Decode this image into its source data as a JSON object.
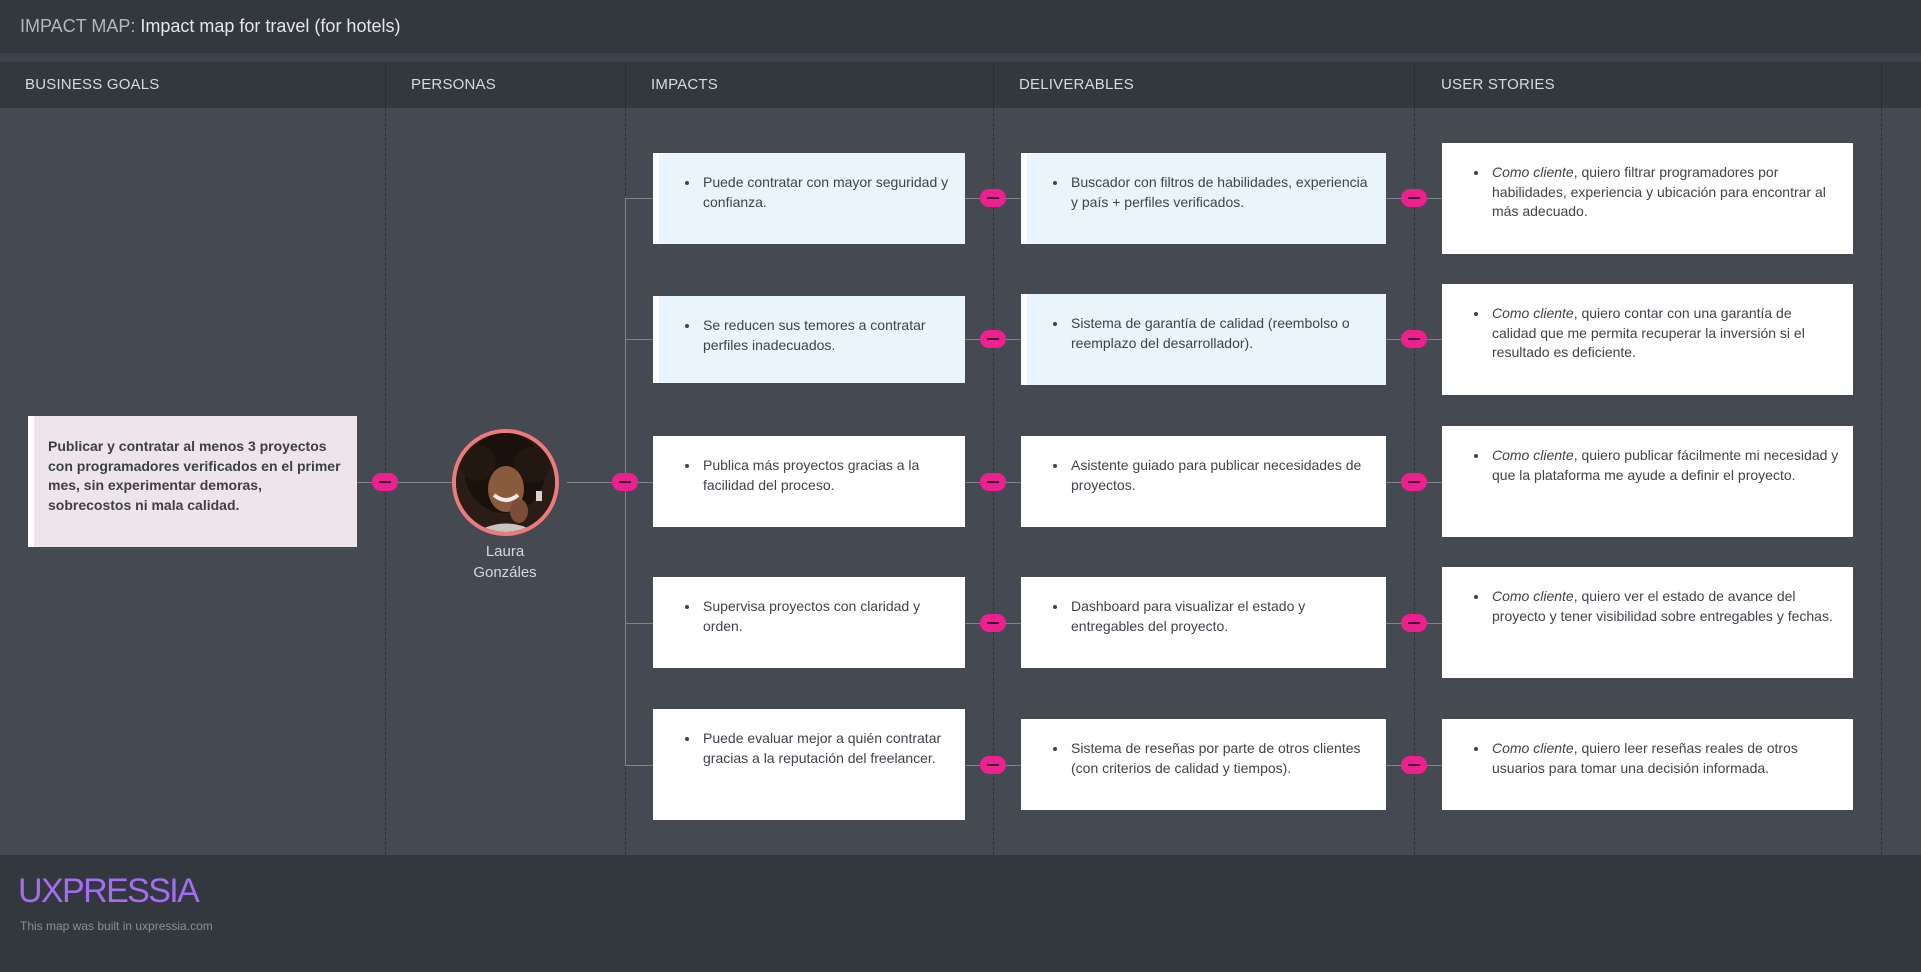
{
  "header": {
    "prefix": "IMPACT MAP:",
    "title": "Impact map for travel (for hotels)"
  },
  "columns": {
    "goals": "BUSINESS GOALS",
    "personas": "PERSONAS",
    "impacts": "IMPACTS",
    "deliverables": "DELIVERABLES",
    "stories": "USER STORIES"
  },
  "goal": {
    "text": "Publicar y contratar al menos 3 proyectos con programadores verificados en el primer mes, sin experimentar demoras, sobrecostos ni mala calidad."
  },
  "persona": {
    "name": "Laura Gonzáles",
    "avatar": "persona-photo"
  },
  "impacts": [
    "Puede contratar con mayor seguridad y confianza.",
    "Se reducen sus temores a contratar perfiles inadecuados.",
    "Publica más proyectos gracias a la facilidad del proceso.",
    "Supervisa proyectos con claridad y orden.",
    "Puede evaluar mejor a quién contratar gracias a la reputación del freelancer."
  ],
  "deliverables": [
    "Buscador con filtros de habilidades, experiencia y país + perfiles verificados.",
    "Sistema de garantía de calidad (reembolso o reemplazo del desarrollador).",
    "Asistente guiado para publicar necesidades de proyectos.",
    "Dashboard para visualizar el estado y entregables del proyecto.",
    "Sistema de reseñas por parte de otros clientes (con criterios de calidad y tiempos)."
  ],
  "stories": {
    "role": "Como cliente",
    "items": [
      ", quiero filtrar programadores por habilidades, experiencia y ubicación para encontrar al más adecuado.",
      ", quiero contar con una garantía de calidad que me permita recuperar la inversión si el resultado es deficiente.",
      ", quiero publicar fácilmente mi necesidad y que la plataforma me ayude a definir el proyecto.",
      ", quiero ver el estado de avance del proyecto y tener visibilidad sobre entregables y fechas.",
      ", quiero leer reseñas reales de otros usuarios para tomar una decisión informada."
    ]
  },
  "footer": {
    "brand": "UXPRESSIA",
    "built_in": "This map was built in uxpressia.com"
  },
  "colors": {
    "accent_node": "#ee1f8f",
    "brand": "#a66cf4",
    "highlight_card": "#e9f4fd",
    "goal_card": "#ede5ea"
  }
}
